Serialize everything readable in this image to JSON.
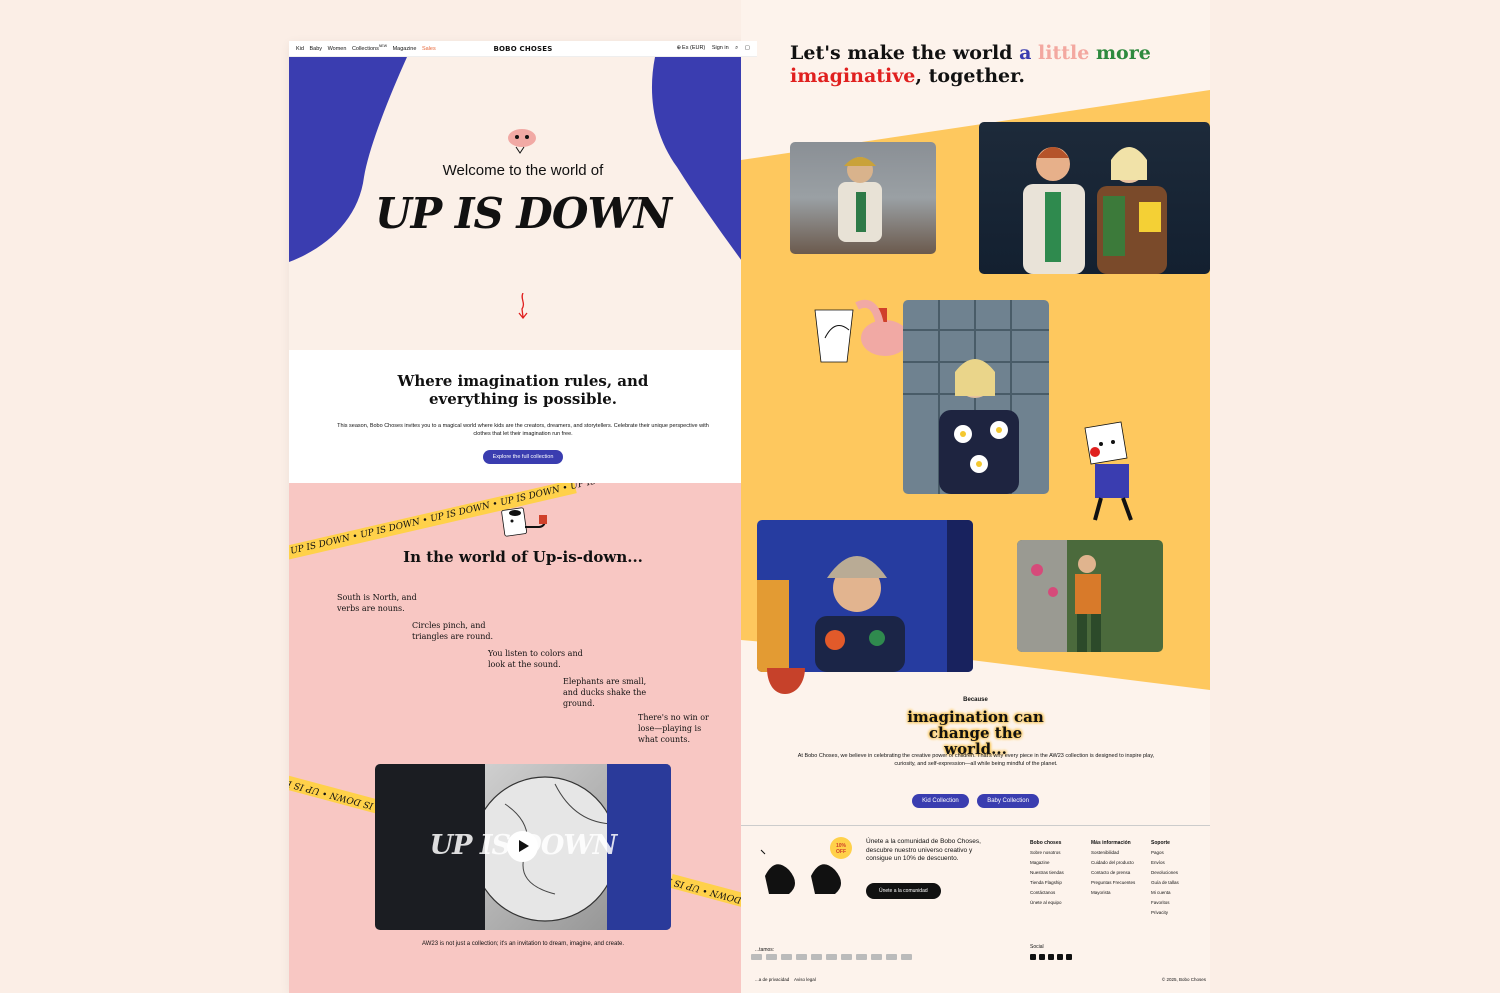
{
  "nav": {
    "links": [
      "Kid",
      "Baby",
      "Women",
      "Collections",
      "Magazine"
    ],
    "new_badge": "NEW",
    "sale_label": "Sales",
    "brand": "BOBO CHOSES",
    "locale": "Es (EUR)",
    "signin": "Sign in"
  },
  "hero": {
    "welcome": "Welcome to the world of",
    "title": "UP IS DOWN"
  },
  "intro": {
    "heading": "Where imagination rules, and everything is possible.",
    "body": "This season, Bobo Choses invites you to a magical world where kids are the creators, dreamers, and storytellers. Celebrate their unique perspective with clothes that let their imagination run free.",
    "cta": "Explore the full collection"
  },
  "pink": {
    "tape_text": "UP IS DOWN  •  UP IS DOWN  •  UP IS DOWN  •  UP IS DOWN  •  UP IS DOWN",
    "heading": "In the world of Up-is-down...",
    "verses": [
      "South is North, and verbs are nouns.",
      "Circles pinch, and triangles are round.",
      "You listen to colors and look at the sound.",
      "Elephants are small, and ducks shake the ground.",
      "There's no win or lose—playing is what counts."
    ],
    "video_title": "UP IS DOWN",
    "caption": "AW23 is not just a collection; it's an invitation to dream, imagine, and create."
  },
  "right": {
    "headline_1": "Let's make the world ",
    "headline_a": "a",
    "headline_little": " little",
    "headline_more": " more",
    "headline_imaginative": "imaginative",
    "headline_end": ", together.",
    "colors": {
      "a": "#3a3db0",
      "little": "#f3a8a0",
      "more": "#2e8a3e",
      "imaginative": "#e0201f"
    },
    "because": "Because",
    "imagination": "imagination can change the world...",
    "body": "At Bobo Choses, we believe in celebrating the creative power of children. That's why every piece in the AW23 collection is designed to inspire play, curiosity, and self-expression—all while being mindful of the planet.",
    "btn_kid": "Kid Collection",
    "btn_baby": "Baby Collection"
  },
  "footer": {
    "discount": "10% OFF",
    "join_text": "Únete a la comunidad de Bobo Choses, descubre nuestro universo creativo y consigue un 10% de descuento.",
    "join_btn": "Únete a la comunidad",
    "col1_title": "Bobo choses",
    "col1": [
      "Sobre nosotros",
      "Magazine",
      "Nuestras tiendas",
      "Tienda Flagship",
      "Contáctanos",
      "Únete al equipo"
    ],
    "col2_title": "Más información",
    "col2": [
      "Sostenibilidad",
      "Cuidado del producto",
      "Contacto de prensa",
      "Preguntas Frecuentes",
      "Mayorista"
    ],
    "col3_title": "Soporte",
    "col3": [
      "Pagos",
      "Envíos",
      "Devoluciones",
      "Guía de tallas",
      "Mi cuenta",
      "Favoritos",
      "Privacity"
    ],
    "pay_label": "...tamos:",
    "social_label": "Social",
    "legal_1": "...a de privacidad",
    "legal_2": "Aviso legal",
    "copyright": "© 2025, Bobo Choses"
  }
}
